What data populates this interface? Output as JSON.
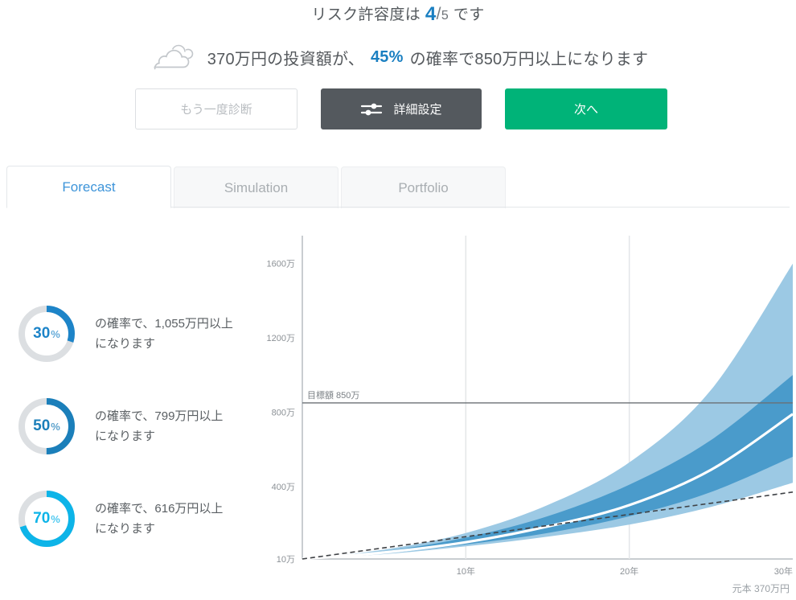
{
  "header": {
    "risk_prefix": "リスク許容度は",
    "risk_value": "4",
    "risk_slash": "/",
    "risk_total": "5",
    "risk_suffix": "です",
    "cloud_icon": "cloud-icon",
    "summary_part1": "370万円の投資額が、",
    "summary_probability": "45%",
    "summary_part2": "の確率で850万円以上になります"
  },
  "buttons": {
    "again_label": "もう一度診断",
    "detail_label": "詳細設定",
    "detail_icon": "slider-settings-icon",
    "next_label": "次へ",
    "next_color": "#00b378",
    "detail_color": "#54595e"
  },
  "tabs": [
    {
      "label": "Forecast",
      "active": true
    },
    {
      "label": "Simulation",
      "active": false
    },
    {
      "label": "Portfolio",
      "active": false
    }
  ],
  "probabilities": [
    {
      "percent": "30",
      "unit": "%",
      "fraction": 0.3,
      "color": "#1d84c8",
      "track": "#dcdfe2",
      "text_line1": "の確率で、1,055万円以上",
      "text_line2": "になります",
      "amount": "1,055万円"
    },
    {
      "percent": "50",
      "unit": "%",
      "fraction": 0.5,
      "color": "#1b7fba",
      "track": "#dcdfe2",
      "text_line1": "の確率で、799万円以上",
      "text_line2": "になります",
      "amount": "799万円"
    },
    {
      "percent": "70",
      "unit": "%",
      "fraction": 0.7,
      "color": "#0db4e8",
      "track": "#dcdfe2",
      "text_line1": "の確率で、616万円以上",
      "text_line2": "になります",
      "amount": "616万円"
    }
  ],
  "chart_data": {
    "type": "area",
    "title": "",
    "xlabel": "",
    "ylabel": "",
    "x": [
      0,
      5,
      10,
      15,
      20,
      25,
      30
    ],
    "x_tick_labels": [
      "10年",
      "20年",
      "30年"
    ],
    "x_ticks": [
      10,
      20,
      30
    ],
    "xlim": [
      0,
      30
    ],
    "y_tick_labels": [
      "10万",
      "400万",
      "800万",
      "1200万",
      "1600万"
    ],
    "y_ticks": [
      10,
      400,
      800,
      1200,
      1600
    ],
    "ylim": [
      10,
      1750
    ],
    "grid": true,
    "legend": "none",
    "goal_line": {
      "label": "目標額 850万",
      "value": 850,
      "color": "#6b7075"
    },
    "principal_line": {
      "label": "元本 370万円",
      "value_end": 370,
      "style": "dashed",
      "color": "#4a4a4a"
    },
    "band_colors": {
      "outer": "#9cc9e4",
      "inner": "#4a9bcb",
      "median": "#ffffff"
    },
    "series": [
      {
        "name": "upper-90",
        "values": [
          10,
          60,
          150,
          300,
          530,
          920,
          1600
        ]
      },
      {
        "name": "upper-70",
        "values": [
          10,
          52,
          125,
          240,
          410,
          650,
          1000
        ]
      },
      {
        "name": "median",
        "values": [
          10,
          45,
          100,
          185,
          300,
          490,
          790
        ]
      },
      {
        "name": "lower-70",
        "values": [
          10,
          40,
          88,
          150,
          240,
          370,
          560
        ]
      },
      {
        "name": "lower-90",
        "values": [
          10,
          36,
          78,
          130,
          195,
          290,
          420
        ]
      },
      {
        "name": "principal",
        "values": [
          10,
          70,
          130,
          190,
          250,
          310,
          370
        ]
      }
    ]
  },
  "chart_notes": {
    "principal": "元本 370万円"
  }
}
